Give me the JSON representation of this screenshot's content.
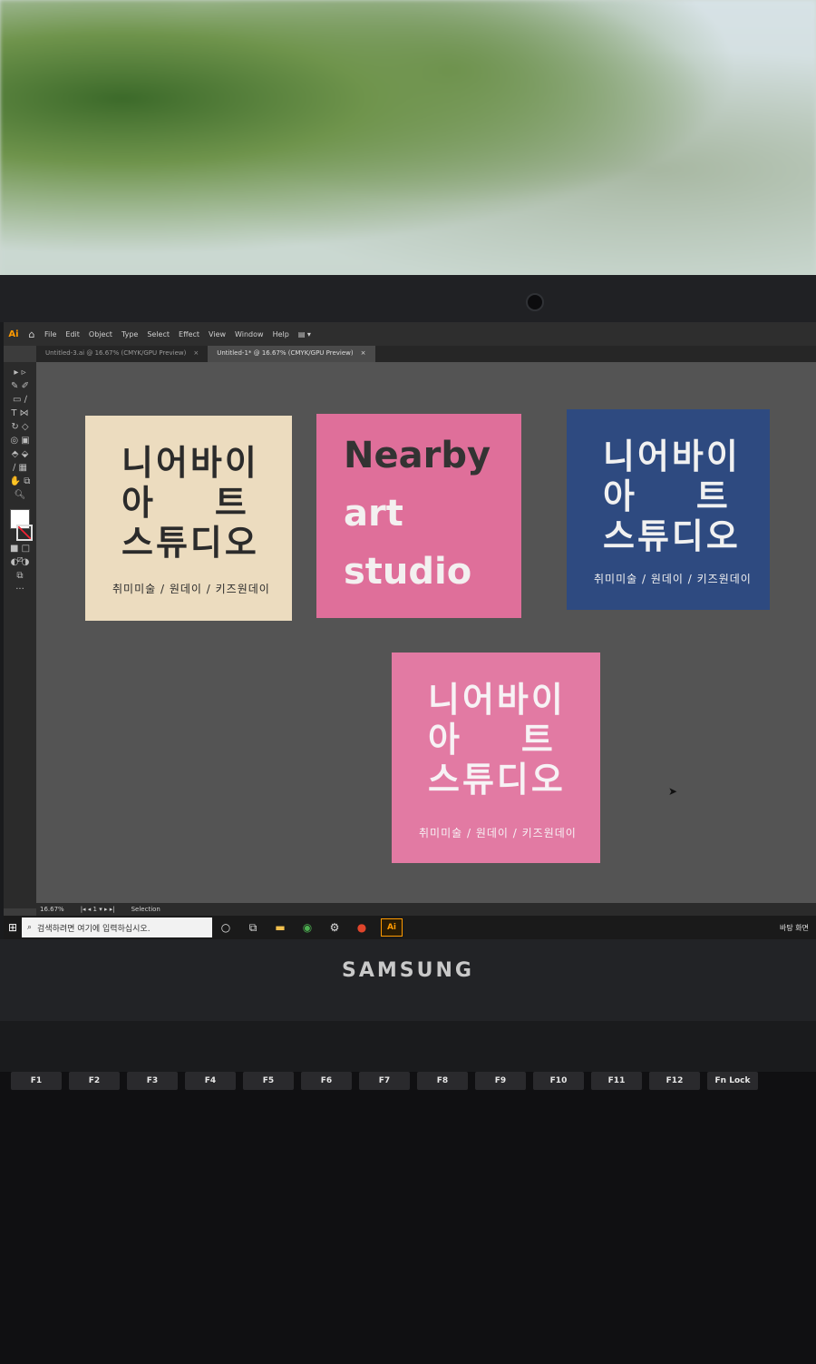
{
  "illustrator": {
    "logo": "Ai",
    "menu": [
      "File",
      "Edit",
      "Object",
      "Type",
      "Select",
      "Effect",
      "View",
      "Window",
      "Help"
    ],
    "tabs": [
      {
        "label": "Untitled-3.ai @ 16.67% (CMYK/GPU Preview)",
        "close": "×"
      },
      {
        "label": "Untitled-1* @ 16.67% (CMYK/GPU Preview)",
        "close": "×"
      }
    ],
    "status": {
      "zoom": "16.67%",
      "artboard": "1",
      "tool": "Selection"
    }
  },
  "cards": {
    "beige": {
      "lines": [
        "니어바이",
        "아    트",
        "스튜디오"
      ],
      "subtitle": "취미미술 / 원데이 / 키즈원데이",
      "bg": "#ecdcbf",
      "fg": "#2b2b2b"
    },
    "pink_en": {
      "lines": [
        "Nearby",
        "art",
        "studio"
      ],
      "bg": "#df6f9a",
      "title_color": "#333333",
      "text_color": "#f3f0f0"
    },
    "navy": {
      "lines": [
        "니어바이",
        "아    트",
        "스튜디오"
      ],
      "subtitle": "취미미술 / 원데이 / 키즈원데이",
      "bg": "#2e4a80",
      "fg": "#f1f1f1"
    },
    "pink_kr": {
      "lines": [
        "니어바이",
        "아    트",
        "스튜디오"
      ],
      "subtitle": "취미미술 / 원데이 / 키즈원데이",
      "bg": "#e27aa3",
      "fg": "#f7f2f5"
    }
  },
  "taskbar": {
    "search_placeholder": "검색하려면 여기에 입력하십시오.",
    "tray": "바탕 화면"
  },
  "laptop": {
    "brand": "SAMSUNG"
  },
  "keyboard": {
    "keys": [
      "F1",
      "F2",
      "F3",
      "F4",
      "F5",
      "F6",
      "F7",
      "F8",
      "F9",
      "F10",
      "F11",
      "F12",
      "Fn Lock"
    ]
  }
}
